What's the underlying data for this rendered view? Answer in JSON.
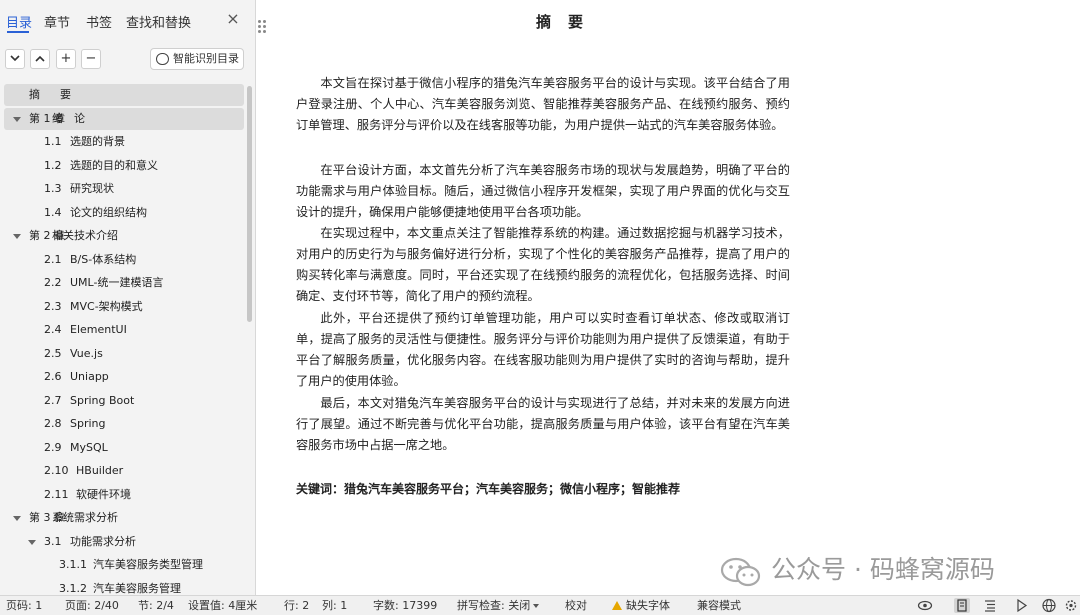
{
  "nav": {
    "tabs": [
      {
        "label": "目录",
        "active": true
      },
      {
        "label": "章节",
        "active": false
      },
      {
        "label": "书签",
        "active": false
      },
      {
        "label": "查找和替换",
        "active": false
      }
    ],
    "close_icon": "×",
    "toolbar": {
      "collapse": "⌄",
      "expand": "⌃",
      "add": "+",
      "remove": "−",
      "smart_toc_label": "智能识别目录"
    },
    "toc": [
      {
        "num": "摘",
        "text": "要",
        "level": 0,
        "selected": true
      },
      {
        "num": "第 1 章",
        "text": "绪　论",
        "level": 0,
        "caret": true,
        "selected": true
      },
      {
        "num": "1.1",
        "text": "选题的背景",
        "level": 1
      },
      {
        "num": "1.2",
        "text": "选题的目的和意义",
        "level": 1
      },
      {
        "num": "1.3",
        "text": "研究现状",
        "level": 1
      },
      {
        "num": "1.4",
        "text": "论文的组织结构",
        "level": 1
      },
      {
        "num": "第 2 章",
        "text": "相关技术介绍",
        "level": 0,
        "caret": true
      },
      {
        "num": "2.1",
        "text": "B/S-体系结构",
        "level": 1
      },
      {
        "num": "2.2",
        "text": "UML-统一建模语言",
        "level": 1
      },
      {
        "num": "2.3",
        "text": "MVC-架构模式",
        "level": 1
      },
      {
        "num": "2.4",
        "text": "ElementUI",
        "level": 1
      },
      {
        "num": "2.5",
        "text": "Vue.js",
        "level": 1
      },
      {
        "num": "2.6",
        "text": "Uniapp",
        "level": 1
      },
      {
        "num": "2.7",
        "text": "Spring Boot",
        "level": 1
      },
      {
        "num": "2.8",
        "text": "Spring",
        "level": 1
      },
      {
        "num": "2.9",
        "text": "MySQL",
        "level": 1
      },
      {
        "num": "2.10",
        "text": "HBuilder",
        "level": 1
      },
      {
        "num": "2.11",
        "text": "软硬件环境",
        "level": 1
      },
      {
        "num": "第 3 章",
        "text": "系统需求分析",
        "level": 0,
        "caret": true
      },
      {
        "num": "3.1",
        "text": "功能需求分析",
        "level": 1,
        "caret": true
      },
      {
        "num": "3.1.1",
        "text": "汽车美容服务类型管理",
        "level": 2
      },
      {
        "num": "3.1.2",
        "text": "汽车美容服务管理",
        "level": 2
      }
    ]
  },
  "document": {
    "title": "摘　要",
    "paragraphs": [
      "本文旨在探讨基于微信小程序的猎兔汽车美容服务平台的设计与实现。该平台结合了用户登录注册、个人中心、汽车美容服务浏览、智能推荐美容服务产品、在线预约服务、预约订单管理、服务评分与评价以及在线客服等功能，为用户提供一站式的汽车美容服务体验。",
      "在平台设计方面，本文首先分析了汽车美容服务市场的现状与发展趋势，明确了平台的功能需求与用户体验目标。随后，通过微信小程序开发框架，实现了用户界面的优化与交互设计的提升，确保用户能够便捷地使用平台各项功能。",
      "在实现过程中，本文重点关注了智能推荐系统的构建。通过数据挖掘与机器学习技术，对用户的历史行为与服务偏好进行分析，实现了个性化的美容服务产品推荐，提高了用户的购买转化率与满意度。同时，平台还实现了在线预约服务的流程优化，包括服务选择、时间确定、支付环节等，简化了用户的预约流程。",
      "此外，平台还提供了预约订单管理功能，用户可以实时查看订单状态、修改或取消订单，提高了服务的灵活性与便捷性。服务评分与评价功能则为用户提供了反馈渠道，有助于平台了解服务质量，优化服务内容。在线客服功能则为用户提供了实时的咨询与帮助，提升了用户的使用体验。",
      "最后，本文对猎兔汽车美容服务平台的设计与实现进行了总结，并对未来的发展方向进行了展望。通过不断完善与优化平台功能，提高服务质量与用户体验，该平台有望在汽车美容服务市场中占据一席之地。"
    ],
    "keywords": "关键词：猎兔汽车美容服务平台；汽车美容服务；微信小程序；智能推荐"
  },
  "watermark": "公众号 · 码蜂窝源码",
  "status": {
    "page_num": "页码: 1",
    "page": "页面: 2/40",
    "section": "节: 2/4",
    "setting": "设置值: 4厘米",
    "row": "行: 2",
    "col": "列: 1",
    "words": "字数: 17399",
    "spell": "拼写检查: 关闭",
    "proof": "校对",
    "missing_font": "缺失字体",
    "compat": "兼容模式"
  },
  "icons": {
    "view_icons": [
      "eye-icon",
      "page-view-icon",
      "outline-view-icon",
      "play-icon",
      "web-icon",
      "settings-icon"
    ]
  },
  "colors": {
    "accent": "#2a61d6",
    "nav_bg": "#f3f3f3",
    "selected_row": "#dcdcdc",
    "warning": "#e6a700"
  }
}
